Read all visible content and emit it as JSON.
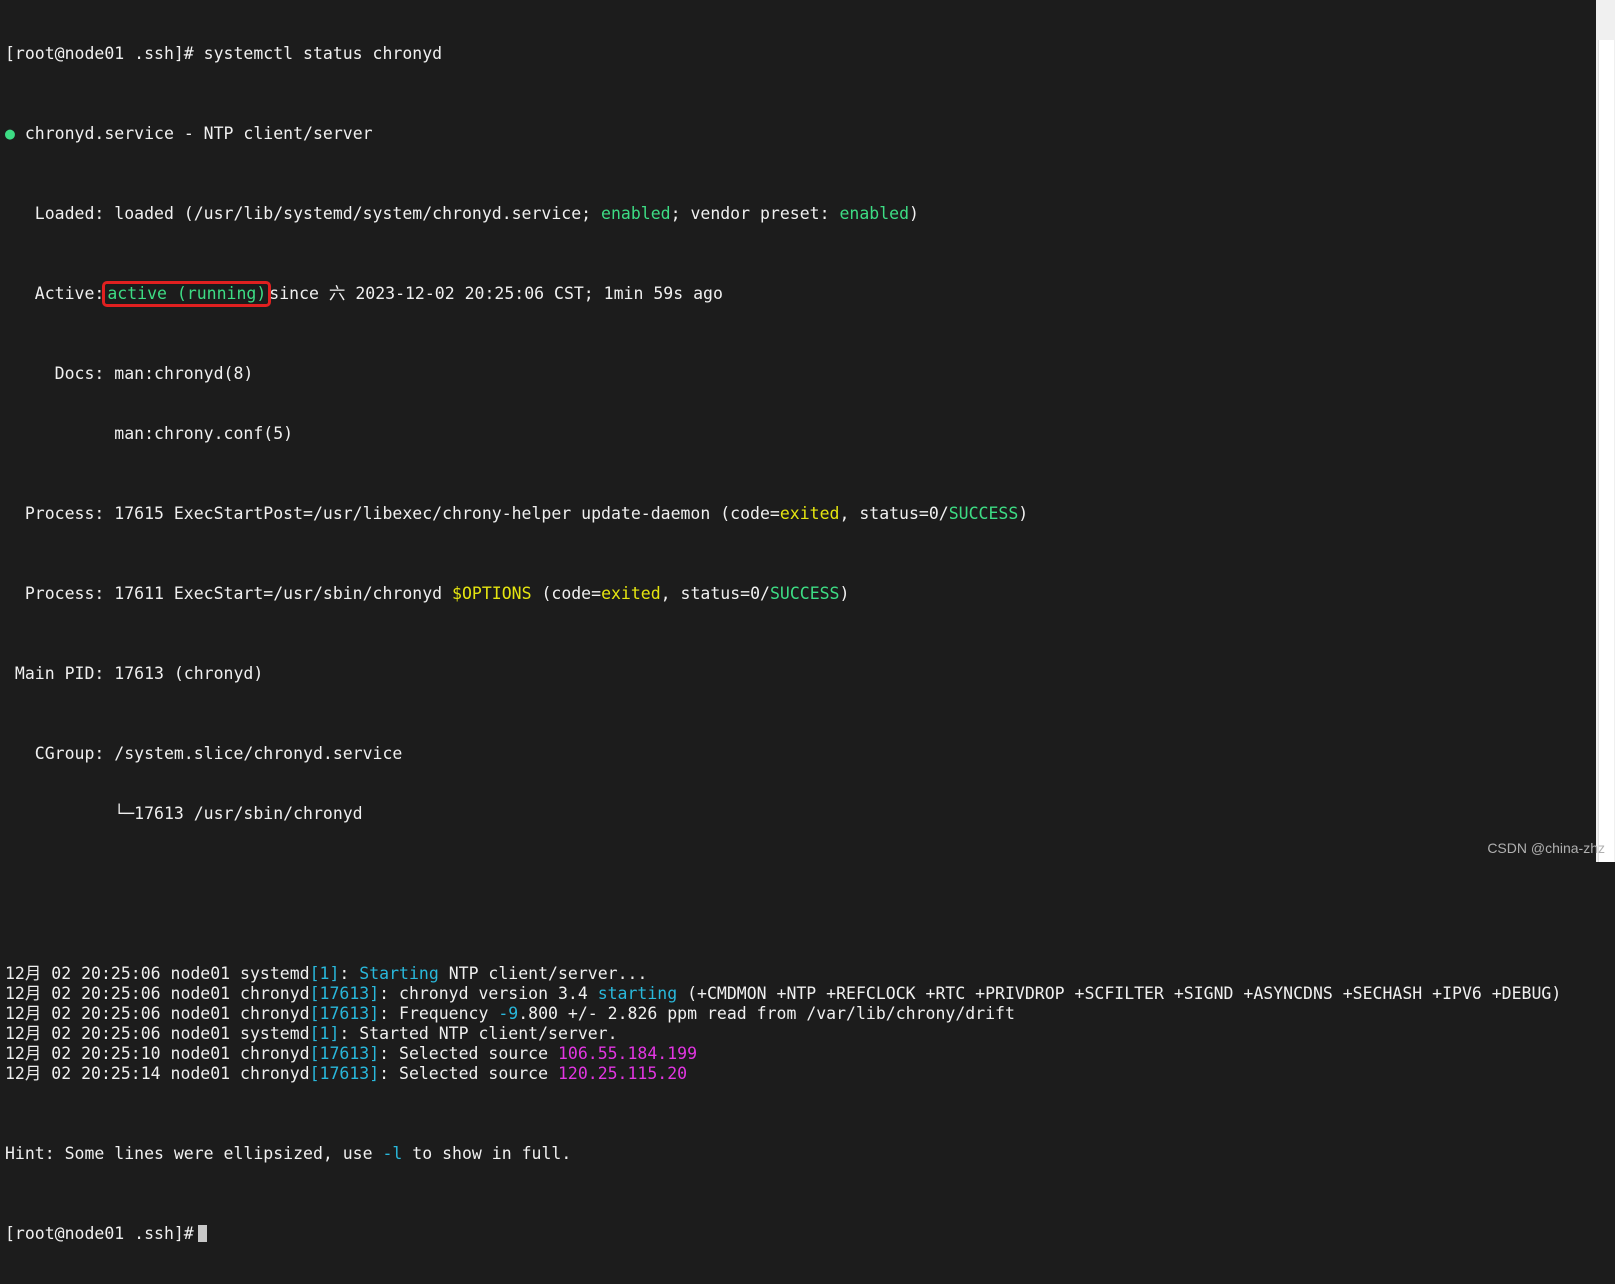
{
  "prompt1": "[root@node01 .ssh]# systemctl status chronyd",
  "service": {
    "dot": "●",
    "title": " chronyd.service - NTP client/server"
  },
  "loaded": {
    "prefix": "   Loaded: loaded (/usr/lib/systemd/system/chronyd.service; ",
    "enabled1": "enabled",
    "mid": "; vendor preset: ",
    "enabled2": "enabled",
    "suffix": ")"
  },
  "active": {
    "prefix": "   Active:",
    "state": "active (running)",
    "suffix": "since 六 2023-12-02 20:25:06 CST; 1min 59s ago"
  },
  "docs": {
    "line1": "     Docs: man:chronyd(8)",
    "line2": "           man:chrony.conf(5)"
  },
  "process1": {
    "prefix": "  Process: 17615 ExecStartPost=/usr/libexec/chrony-helper update-daemon (code=",
    "code": "exited",
    "mid": ", status=0/",
    "status": "SUCCESS",
    "suffix": ")"
  },
  "process2": {
    "prefix": "  Process: 17611 ExecStart=/usr/sbin/chronyd ",
    "options": "$OPTIONS",
    "mid1": " (code=",
    "code": "exited",
    "mid2": ", status=0/",
    "status": "SUCCESS",
    "suffix": ")"
  },
  "mainpid": " Main PID: 17613 (chronyd)",
  "cgroup": {
    "line1": "   CGroup: /system.slice/chronyd.service",
    "line2": "           └─17613 /usr/sbin/chronyd"
  },
  "log": [
    {
      "prefix": "12月 02 20:25:06 node01 systemd",
      "pid": "[1]",
      "sep": ": ",
      "hl": "Starting",
      "rest": " NTP client/server...",
      "hl_color": "cyan"
    },
    {
      "prefix": "12月 02 20:25:06 node01 chronyd",
      "pid": "[17613]",
      "sep": ": chronyd version 3.4 ",
      "hl": "starting",
      "rest": " (+CMDMON +NTP +REFCLOCK +RTC +PRIVDROP +SCFILTER +SIGND +ASYNCDNS +SECHASH +IPV6 +DEBUG)",
      "hl_color": "cyan"
    },
    {
      "prefix": "12月 02 20:25:06 node01 chronyd",
      "pid": "[17613]",
      "sep": ": Frequency ",
      "hl": "-9",
      "rest": ".800 +/- 2.826 ppm read from /var/lib/chrony/drift",
      "hl_color": "cyan"
    },
    {
      "prefix": "12月 02 20:25:06 node01 systemd",
      "pid": "[1]",
      "sep": ": Started NTP client/server.",
      "hl": "",
      "rest": "",
      "hl_color": "cyan"
    },
    {
      "prefix": "12月 02 20:25:10 node01 chronyd",
      "pid": "[17613]",
      "sep": ": Selected source ",
      "hl": "106.55.184.199",
      "rest": "",
      "hl_color": "magenta"
    },
    {
      "prefix": "12月 02 20:25:14 node01 chronyd",
      "pid": "[17613]",
      "sep": ": Selected source ",
      "hl": "120.25.115.20",
      "rest": "",
      "hl_color": "magenta"
    }
  ],
  "hint": {
    "prefix": "Hint: Some lines were ellipsized, use ",
    "flag": "-l",
    "suffix": " to show in full."
  },
  "prompt2": "[root@node01 .ssh]#",
  "watermark": "CSDN @china-zhz",
  "colors": {
    "background": "#1c1c1c",
    "text": "#f0f0f0",
    "green": "#3ddc84",
    "yellow": "#e5e510",
    "cyan": "#29b8db",
    "magenta": "#e236e2",
    "highlight_box": "#e02020"
  }
}
